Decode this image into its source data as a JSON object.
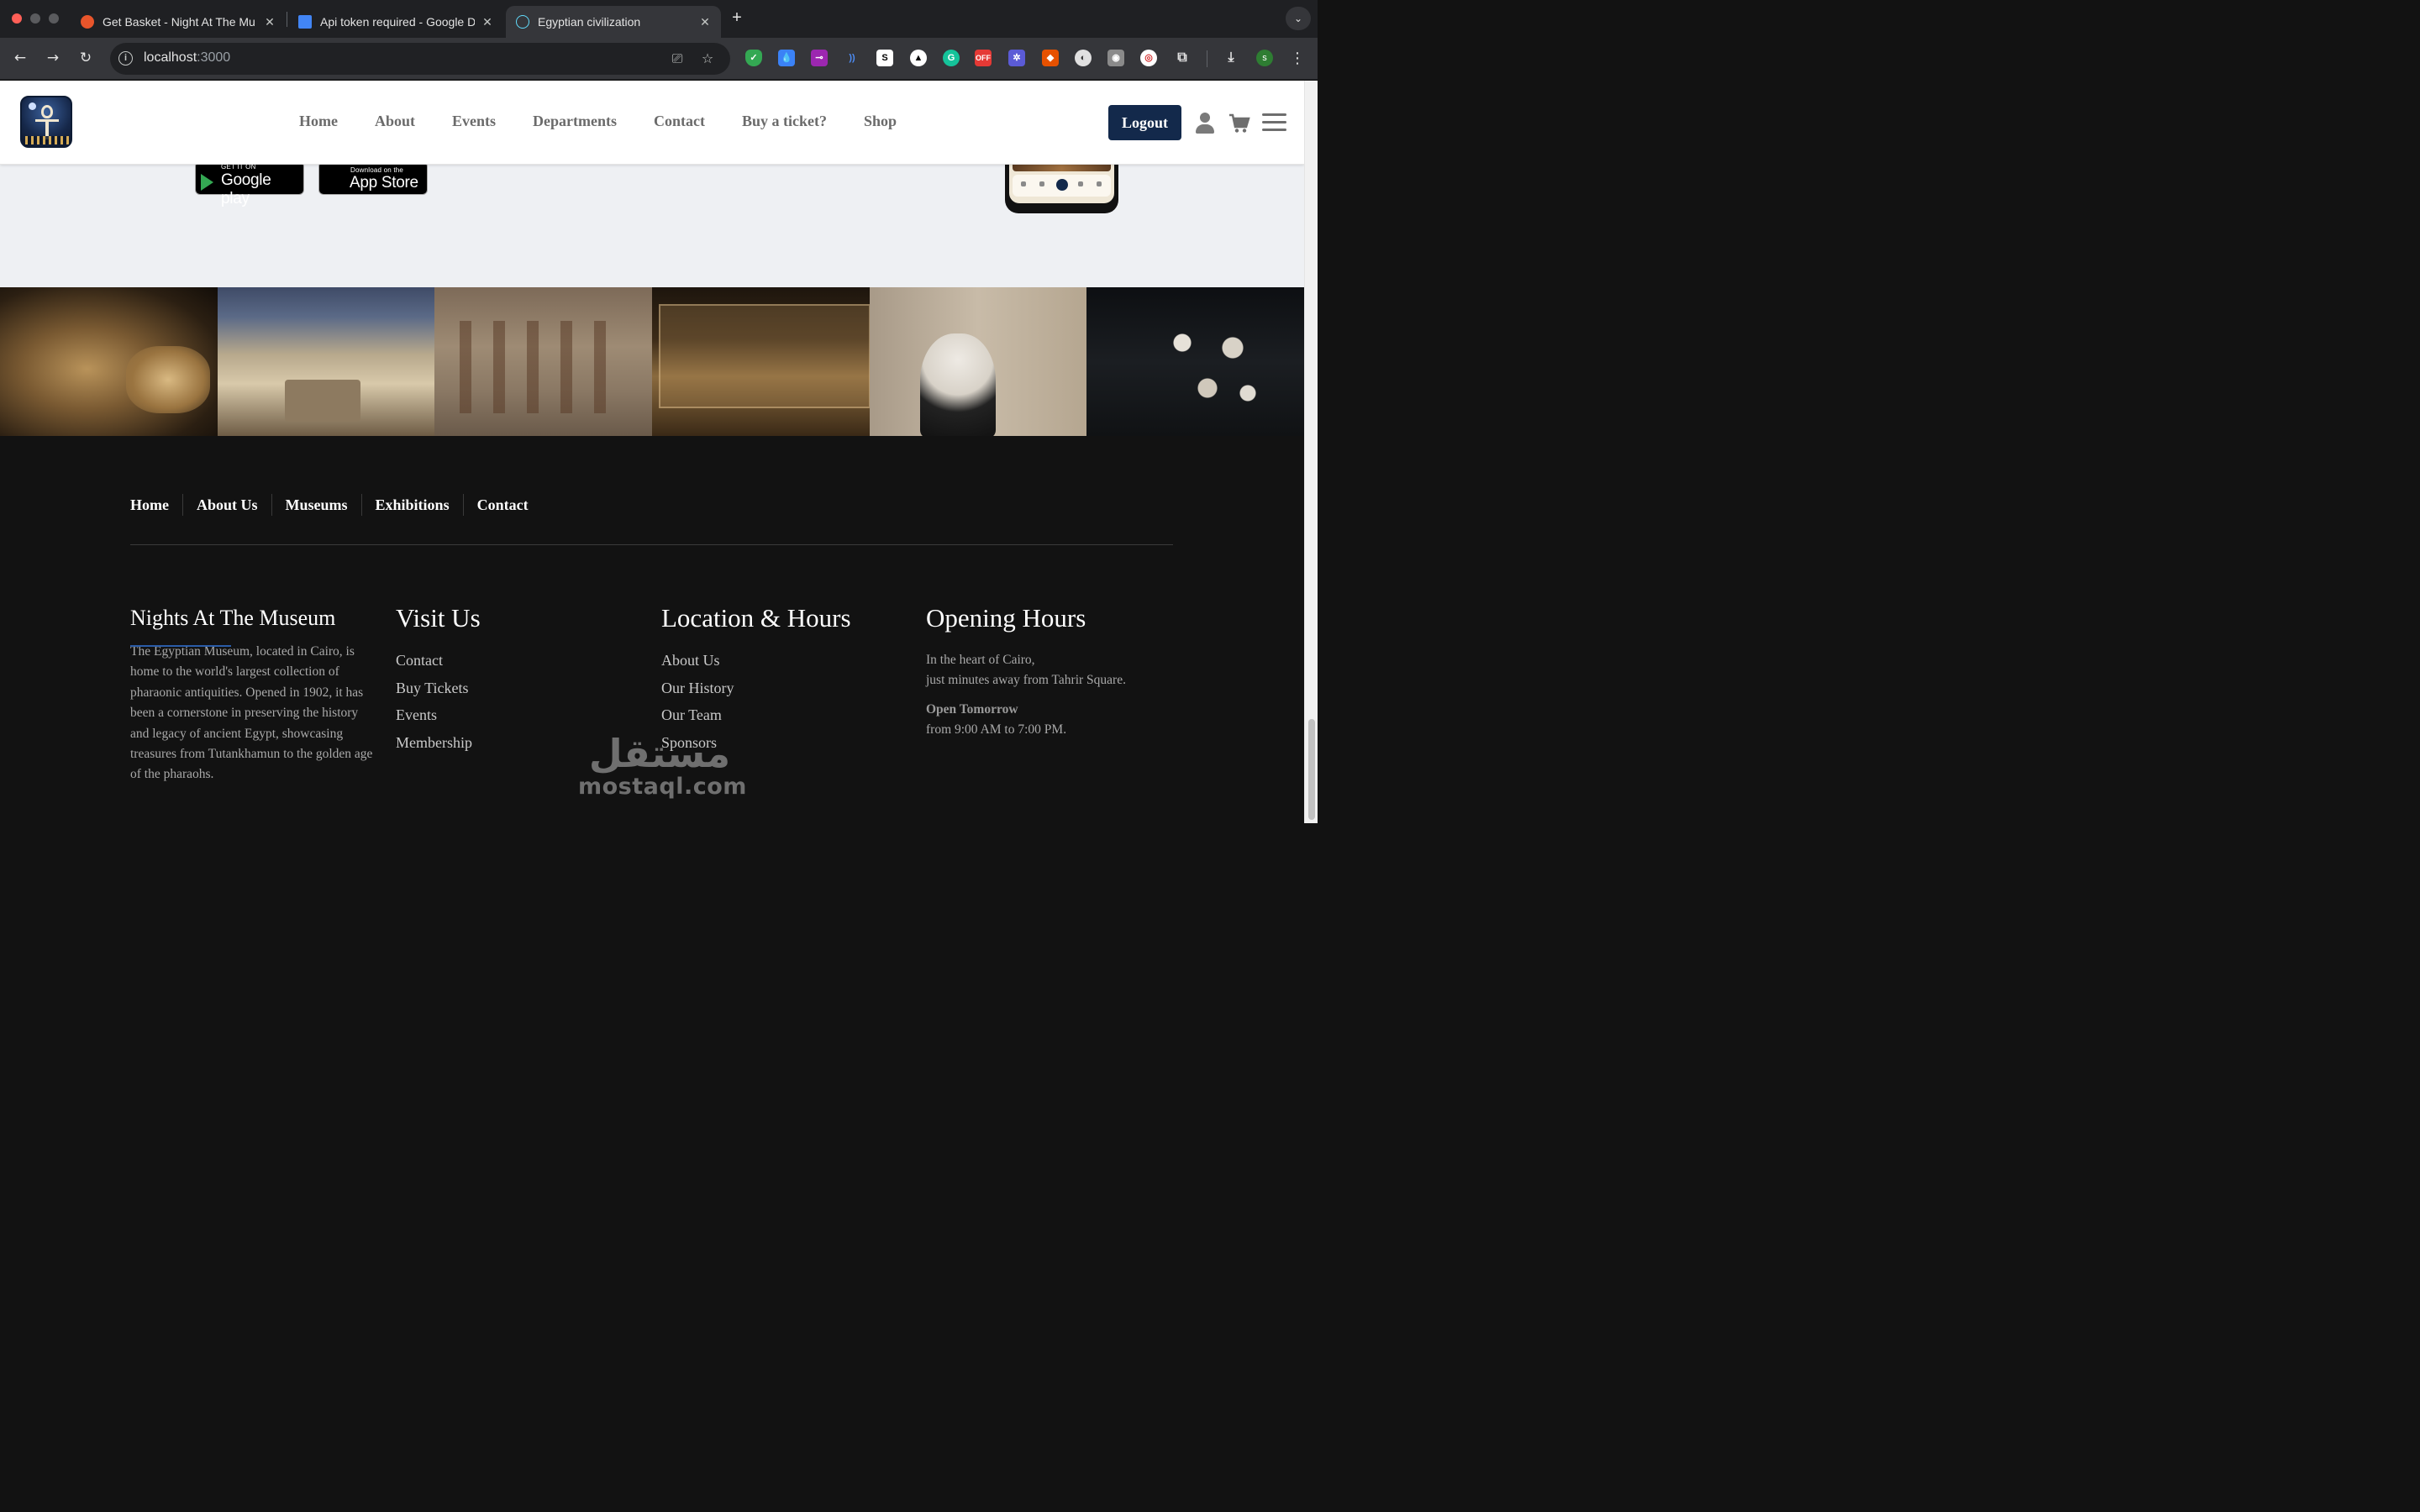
{
  "browser": {
    "tabs": [
      {
        "title": "Get Basket - Night At The Mu",
        "favicon": "basket-logo-icon",
        "favicon_color": "#e8552b",
        "active": false
      },
      {
        "title": "Api token required - Google D",
        "favicon": "google-docs-icon",
        "favicon_color": "#4285f4",
        "active": false
      },
      {
        "title": "Egyptian civilization",
        "favicon": "react-logo-icon",
        "favicon_color": "#61dafb",
        "active": true
      }
    ],
    "url_host": "localhost",
    "url_port": ":3000",
    "profile_initial": "s",
    "extension_off_badge": "OFF"
  },
  "site": {
    "nav": [
      "Home",
      "About",
      "Events",
      "Departments",
      "Contact",
      "Buy a ticket?",
      "Shop"
    ],
    "logout_label": "Logout",
    "brand_color": "#13294b"
  },
  "promo": {
    "google_play_small": "GET IT ON",
    "google_play_big": "Google play",
    "app_store_small": "Download on the",
    "app_store_big": "App Store"
  },
  "gallery": [
    {
      "subject": "mummy"
    },
    {
      "subject": "painted tomb interior"
    },
    {
      "subject": "relief carving"
    },
    {
      "subject": "mummy in glass case"
    },
    {
      "subject": "visitor photographing wall"
    },
    {
      "subject": "marble busts exhibit"
    }
  ],
  "footer": {
    "links": [
      "Home",
      "About Us",
      "Museums",
      "Exhibitions",
      "Contact"
    ],
    "about": {
      "title": "Nights At The Museum",
      "text": "The Egyptian Museum, located in Cairo, is home to the world's largest collection of pharaonic antiquities. Opened in 1902, it has been a cornerstone in preserving the history and legacy of ancient Egypt, showcasing treasures from Tutankhamun to the golden age of the pharaohs."
    },
    "visit": {
      "title": "Visit Us",
      "items": [
        "Contact",
        "Buy Tickets",
        "Events",
        "Membership"
      ]
    },
    "location": {
      "title": "Location & Hours",
      "items": [
        "About Us",
        "Our History",
        "Our Team",
        "Sponsors"
      ]
    },
    "opening": {
      "title": "Opening Hours",
      "line1": "In the heart of Cairo,",
      "line2": "just minutes away from Tahrir Square.",
      "strong": "Open Tomorrow",
      "hours": "from 9:00 AM to 7:00 PM."
    }
  },
  "watermark": {
    "arabic": "مستقل",
    "latin": "mostaql.com"
  }
}
